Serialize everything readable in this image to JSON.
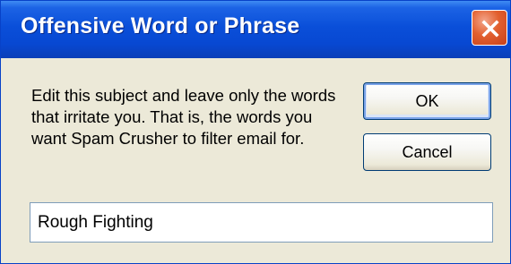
{
  "dialog": {
    "title": "Offensive Word or Phrase",
    "message": "Edit this subject and leave only the words that irritate you. That is, the words you want Spam Crusher to filter email for.",
    "ok_label": "OK",
    "cancel_label": "Cancel",
    "input_value": "Rough Fighting",
    "close_icon": "close-icon"
  },
  "colors": {
    "titlebar": "#0a4fd9",
    "window_face": "#ece9d8",
    "close_button": "#d9542b",
    "button_border": "#003c74"
  }
}
